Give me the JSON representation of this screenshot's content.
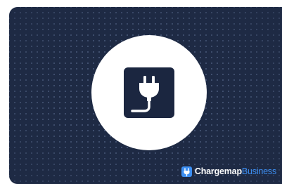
{
  "card": {
    "background_color": "#1e2a44",
    "accent_color": "#3d8ff2",
    "center_icon": "plug-icon"
  },
  "brand": {
    "logo_icon": "chargemap-logo-icon",
    "name": "Chargemap",
    "suffix": "Business"
  }
}
